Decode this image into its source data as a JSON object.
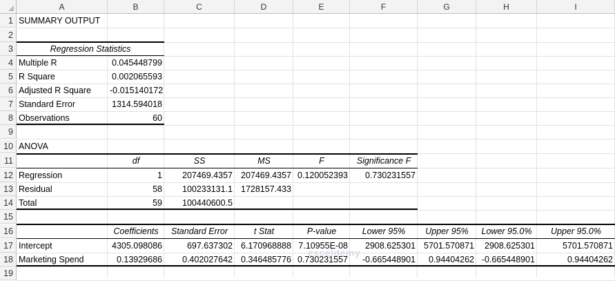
{
  "columns": [
    "A",
    "B",
    "C",
    "D",
    "E",
    "F",
    "G",
    "H",
    "I"
  ],
  "rows": [
    "1",
    "2",
    "3",
    "4",
    "5",
    "6",
    "7",
    "8",
    "9",
    "10",
    "11",
    "12",
    "13",
    "14",
    "15",
    "16",
    "17",
    "18",
    "19"
  ],
  "title": "SUMMARY OUTPUT",
  "regression_statistics": {
    "header": "Regression Statistics",
    "items": [
      {
        "label": "Multiple R",
        "value": "0.045448799"
      },
      {
        "label": "R Square",
        "value": "0.002065593"
      },
      {
        "label": "Adjusted R Square",
        "value": "-0.015140172"
      },
      {
        "label": "Standard Error",
        "value": "1314.594018"
      },
      {
        "label": "Observations",
        "value": "60"
      }
    ]
  },
  "anova": {
    "title": "ANOVA",
    "headers": [
      "df",
      "SS",
      "MS",
      "F",
      "Significance F"
    ],
    "rows": [
      {
        "label": "Regression",
        "cells": [
          "1",
          "207469.4357",
          "207469.4357",
          "0.120052393",
          "0.730231557"
        ]
      },
      {
        "label": "Residual",
        "cells": [
          "58",
          "100233131.1",
          "1728157.433",
          "",
          ""
        ]
      },
      {
        "label": "Total",
        "cells": [
          "59",
          "100440600.5",
          "",
          "",
          ""
        ]
      }
    ]
  },
  "coefficients": {
    "headers": [
      "Coefficients",
      "Standard Error",
      "t Stat",
      "P-value",
      "Lower 95%",
      "Upper 95%",
      "Lower 95.0%",
      "Upper 95.0%"
    ],
    "rows": [
      {
        "label": "Intercept",
        "cells": [
          "4305.098086",
          "697.637302",
          "6.170968888",
          "7.10955E-08",
          "2908.625301",
          "5701.570871",
          "2908.625301",
          "5701.570871"
        ]
      },
      {
        "label": "Marketing Spend",
        "cells": [
          "0.13929686",
          "0.402027642",
          "0.346485776",
          "0.730231557",
          "-0.665448901",
          "0.94404262",
          "-0.665448901",
          "0.94404262"
        ]
      }
    ]
  },
  "watermark": "exceldemy"
}
